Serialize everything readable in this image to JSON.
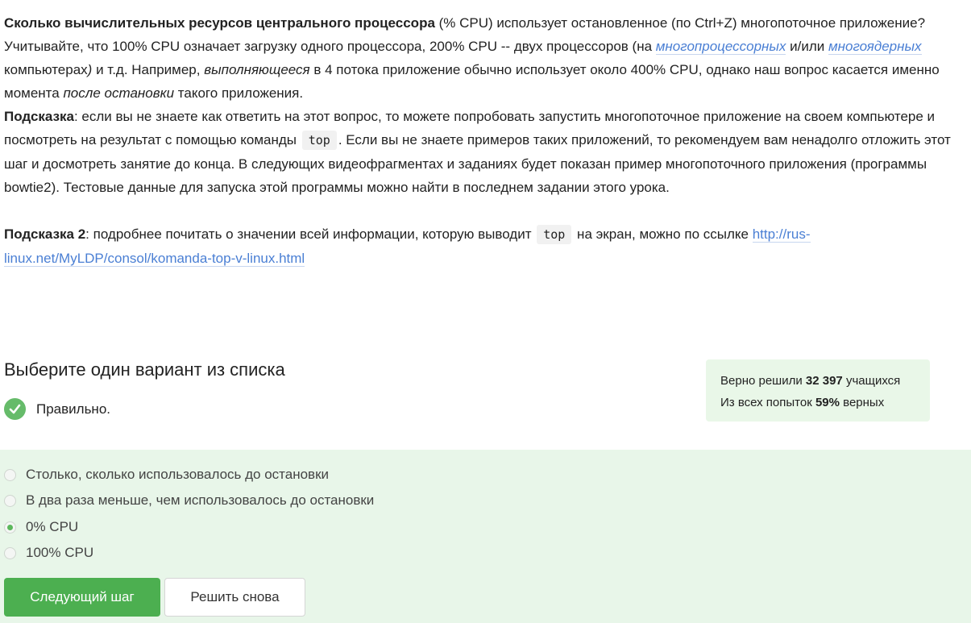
{
  "question": {
    "p1_bold": "Сколько вычислительных ресурсов центрального процессора",
    "p1_rest": " (% CPU) использует остановленное (по Ctrl+Z) многопоточное приложение?",
    "p2_a": "Учитывайте, что 100% CPU означает загрузку одного процессора, 200% CPU -- двух процессоров (на ",
    "p2_link1": "многопроцессорных",
    "p2_b": " и/или ",
    "p2_link2": "многоядерных",
    "p2_c": " компьютерах",
    "p2_c2": ")",
    "p2_d": " и т.д. Например, ",
    "p2_italic1": "выполняющееся",
    "p2_e": " в 4 потока приложение обычно использует около 400% CPU, однако наш вопрос касается именно момента ",
    "p2_italic2": "после остановки",
    "p2_f": " такого приложения.",
    "hint1_label": "Подсказка",
    "hint1_a": ": если вы не знаете как ответить на этот вопрос, то можете попробовать запустить многопоточное приложение на своем компьютере и посмотреть на результат с помощью команды ",
    "hint1_code": "top",
    "hint1_b": ". Если вы не знаете примеров таких приложений, то рекомендуем вам ненадолго отложить этот шаг и досмотреть занятие до конца. В следующих видеофрагментах и заданиях будет показан пример многопоточного приложения (программы bowtie2). Тестовые данные для запуска этой программы можно найти в последнем задании этого урока.",
    "hint2_label": "Подсказка 2",
    "hint2_a": ": подробнее почитать о значении всей информации, которую выводит ",
    "hint2_code": "top",
    "hint2_b": " на экран, можно по ссылке ",
    "hint2_link": "http://rus-linux.net/MyLDP/consol/komanda-top-v-linux.html"
  },
  "quiz": {
    "title": "Выберите один вариант из списка",
    "result_text": "Правильно.",
    "options": [
      {
        "label": "Столько, сколько использовалось до остановки",
        "selected": false
      },
      {
        "label": "В два раза меньше, чем использовалось до остановки",
        "selected": false
      },
      {
        "label": "0% CPU",
        "selected": true
      },
      {
        "label": "100% CPU",
        "selected": false
      }
    ],
    "next_button": "Следующий шаг",
    "retry_button": "Решить снова"
  },
  "stats": {
    "solved_prefix": "Верно решили ",
    "solved_count": "32 397",
    "solved_suffix": " учащихся",
    "attempts_prefix": "Из всех попыток ",
    "attempts_percent": "59%",
    "attempts_suffix": " верных"
  },
  "colors": {
    "accent_green": "#4caf50",
    "check_green": "#66bb6a",
    "options_bg": "#e8f6e9",
    "stats_bg": "#e9f7e8",
    "link": "#4a7fd4"
  },
  "icons": {
    "result": "check-circle-icon"
  }
}
